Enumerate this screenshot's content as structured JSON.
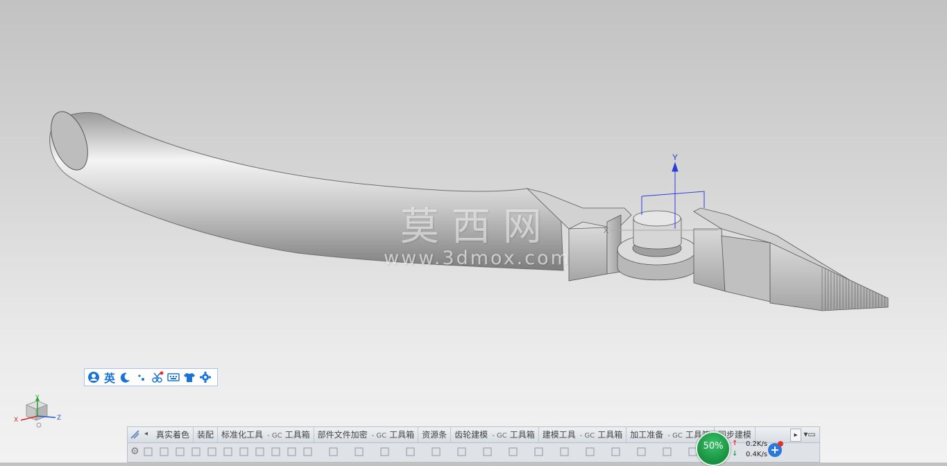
{
  "watermark": {
    "title": "莫西网",
    "url": "www.3dmox.com"
  },
  "model": {
    "axis_label_y": "Y",
    "axis_label_x": "X"
  },
  "triad": {
    "x": "X",
    "y": "Y",
    "z": "Z"
  },
  "ime_bar": {
    "lang_label": "英",
    "icons": [
      "user-icon",
      "moon-icon",
      "punctuation-icon",
      "scissors-icon",
      "keyboard-icon",
      "skin-shirt-icon",
      "settings-gear-icon"
    ],
    "accent": "#1a73d9"
  },
  "toolbar": {
    "tabs": [
      {
        "label": "真实着色"
      },
      {
        "label": "装配"
      },
      {
        "label": "标准化工具",
        "suffix": "- GC",
        "suffix2": "工具箱"
      },
      {
        "label": "部件文件加密",
        "suffix": "- GC",
        "suffix2": "工具箱"
      },
      {
        "label": "资源条"
      },
      {
        "label": "齿轮建模",
        "suffix": "- GC",
        "suffix2": "工具箱"
      },
      {
        "label": "建模工具",
        "suffix": "- GC",
        "suffix2": "工具箱"
      },
      {
        "label": "加工准备",
        "suffix": "- GC",
        "suffix2": "工具箱"
      },
      {
        "label": "同步建模"
      }
    ]
  },
  "network_widget": {
    "percent": "50%",
    "upload": "0.2K/s",
    "download": "0.4K/s",
    "ring_color": "#1e9a49"
  }
}
